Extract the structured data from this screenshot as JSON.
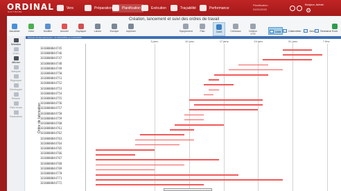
{
  "header": {
    "logo": "ORDINAL",
    "logo_sub": "SOFTWARE",
    "nav": [
      {
        "label": "Vers"
      },
      {
        "label": "Préparation"
      },
      {
        "label": "Planification"
      },
      {
        "label": "Exécution"
      },
      {
        "label": "Traçabilité"
      },
      {
        "label": "Performance"
      }
    ],
    "date_line1": "Planification",
    "date_line2": "31/01/2022",
    "user_line1": "Bonjour, Admin",
    "user_line2": "Admin"
  },
  "window": {
    "title": "Création, lancement et suivi des ordres de travail",
    "toolbar": [
      {
        "label": "Actualiser",
        "icon": "refresh-icon"
      },
      {
        "label": "Créer",
        "icon": "add-icon"
      },
      {
        "label": "Modifier",
        "icon": "edit-icon"
      },
      {
        "label": "Annuler",
        "icon": "delete-icon"
      },
      {
        "label": "Dupliquer",
        "icon": "duplicate-icon"
      },
      {
        "label": "Lancer",
        "icon": "launch-icon"
      },
      {
        "label": "Envoyer",
        "icon": "send-icon"
      },
      {
        "label": "Imprimer",
        "icon": "print-icon"
      },
      {
        "label": "Equipement",
        "icon": "equipment-icon"
      },
      {
        "label": "Plan",
        "icon": "plan-icon"
      },
      {
        "label": "Gantt",
        "icon": "gantt-icon"
      },
      {
        "label": "Créneaux",
        "icon": "slots-icon"
      },
      {
        "label": "Gestion OTS",
        "icon": "ots-icon"
      }
    ],
    "views": [
      {
        "label": "Liste"
      },
      {
        "label": "Calendrier"
      },
      {
        "label": "Jour"
      },
      {
        "label": "Semaine"
      }
    ],
    "export_label": "Excel",
    "filter_text": "Période d'ordonnancement : du 20/12/2021 au 31/01/2022"
  },
  "sidebar": [
    {
      "label": "Sélection",
      "icon": "select-icon",
      "active": true
    },
    {
      "label": "Zoom",
      "icon": "zoom-icon",
      "active": false
    },
    {
      "label": "Afficher",
      "icon": "display-icon",
      "active": true
    },
    {
      "label": "Masquer",
      "icon": "hide-icon",
      "active": false
    },
    {
      "label": "Regrouper",
      "icon": "group-icon",
      "active": false
    },
    {
      "label": "Développer",
      "icon": "expand-icon",
      "active": false
    },
    {
      "label": "Réduire",
      "icon": "collapse-icon",
      "active": false
    },
    {
      "label": "Plein écran",
      "icon": "fullscreen-icon",
      "active": false
    },
    {
      "label": "Paramètres",
      "icon": "settings-icon",
      "active": false
    }
  ],
  "chart_data": {
    "type": "gantt",
    "ylabel": "Ordre de fabrication",
    "ticks": [
      "3 janv.",
      "10 janv.",
      "17 janv.",
      "24 janv.",
      "31 janv.",
      "7 févr."
    ],
    "tick_days": [
      14,
      21,
      28,
      35,
      42,
      49
    ],
    "x_range_days": [
      0,
      52
    ],
    "x_origin_date": "2021-12-20",
    "bar_color": "#f25959",
    "rows": [
      {
        "label": "1010000044745",
        "start": 40,
        "end": 46
      },
      {
        "label": "1010000044746",
        "start": 40,
        "end": 48
      },
      {
        "label": "1010000044747",
        "start": 36,
        "end": 46
      },
      {
        "label": "1010000044748",
        "start": 31,
        "end": 37
      },
      {
        "label": "1010000044749",
        "start": 29,
        "end": 40
      },
      {
        "label": "1010000044750",
        "start": 26,
        "end": 37
      },
      {
        "label": "1010000044751",
        "start": 25,
        "end": 27
      },
      {
        "label": "1010000044752",
        "start": 24,
        "end": 30
      },
      {
        "label": "1010000044753",
        "start": 25,
        "end": 27
      },
      {
        "label": "1010000044754",
        "start": 24,
        "end": 26
      },
      {
        "label": "1010000044755",
        "start": 21,
        "end": 36
      },
      {
        "label": "1010000044756",
        "start": 22,
        "end": 36
      },
      {
        "label": "1010000044757",
        "start": 21,
        "end": 35
      },
      {
        "label": "1010000044758",
        "start": 20,
        "end": 24
      },
      {
        "label": "1010000044759",
        "start": 20,
        "end": 24
      },
      {
        "label": "1010000044760",
        "start": 18,
        "end": 28
      },
      {
        "label": "1010000044761",
        "start": 17,
        "end": 22
      },
      {
        "label": "1010000044762",
        "start": 11,
        "end": 20
      },
      {
        "label": "1010000044763",
        "start": 10,
        "end": 22
      },
      {
        "label": "1010000044764",
        "start": 10,
        "end": 19
      },
      {
        "label": "1010000044765",
        "start": 2,
        "end": 14
      },
      {
        "label": "1010000044766",
        "start": 2,
        "end": 10
      },
      {
        "label": "1010000044767",
        "start": 2,
        "end": 27
      },
      {
        "label": "1010000044768",
        "start": 2,
        "end": 20
      },
      {
        "label": "1010000044769",
        "start": 2,
        "end": 14
      },
      {
        "label": "1010000044770",
        "start": 2,
        "end": 31
      },
      {
        "label": "1010000044771",
        "start": 2,
        "end": 40
      },
      {
        "label": "1010000044772",
        "start": 2,
        "end": 24
      }
    ]
  }
}
